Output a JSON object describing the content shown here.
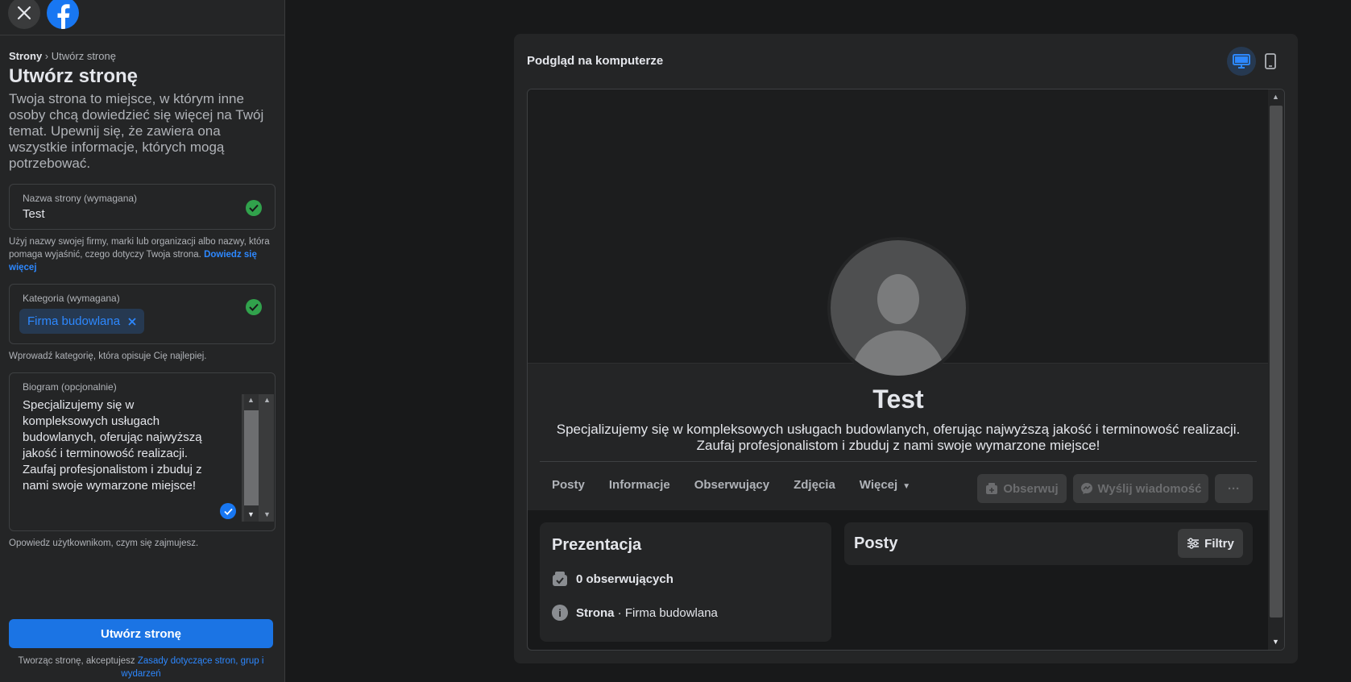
{
  "breadcrumb": {
    "root": "Strony",
    "separator": "›",
    "current": "Utwórz stronę"
  },
  "title": "Utwórz stronę",
  "description": "Twoja strona to miejsce, w którym inne osoby chcą dowiedzieć się więcej na Twój temat. Upewnij się, że zawiera ona wszystkie informacje, których mogą potrzebować.",
  "name_field": {
    "label": "Nazwa strony (wymagana)",
    "value": "Test",
    "helper": "Użyj nazwy swojej firmy, marki lub organizacji albo nazwy, która pomaga wyjaśnić, czego dotyczy Twoja strona.",
    "helper_link": "Dowiedz się więcej"
  },
  "category_field": {
    "label": "Kategoria (wymagana)",
    "chip": "Firma budowlana",
    "helper": "Wprowadź kategorię, która opisuje Cię najlepiej."
  },
  "bio_field": {
    "label": "Biogram (opcjonalnie)",
    "value": "Specjalizujemy się w kompleksowych usługach budowlanych, oferując najwyższą jakość i terminowość realizacji. Zaufaj profesjonalistom i zbuduj z nami swoje wymarzone miejsce!",
    "helper": "Opowiedz użytkownikom, czym się zajmujesz."
  },
  "create_button": "Utwórz stronę",
  "terms": {
    "text": "Tworząc stronę, akceptujesz",
    "link": "Zasady dotyczące stron, grup i wydarzeń"
  },
  "preview": {
    "title": "Podgląd na komputerze",
    "page_name": "Test",
    "page_bio": "Specjalizujemy się w kompleksowych usługach budowlanych, oferując najwyższą jakość i terminowość realizacji. Zaufaj profesjonalistom i zbuduj z nami swoje wymarzone miejsce!",
    "tabs": [
      "Posty",
      "Informacje",
      "Obserwujący",
      "Zdjęcia",
      "Więcej"
    ],
    "follow_button": "Obserwuj",
    "message_button": "Wyślij wiadomość",
    "more_button": "···",
    "intro": {
      "title": "Prezentacja",
      "followers": "0 obserwujących",
      "page_label": "Strona",
      "page_category": " · Firma budowlana"
    },
    "posts": {
      "title": "Posty",
      "filter_button": "Filtry"
    }
  },
  "colors": {
    "accent": "#1b74e4",
    "link": "#2d88ff",
    "success": "#31a24c",
    "background": "#18191a",
    "surface": "#242526"
  }
}
